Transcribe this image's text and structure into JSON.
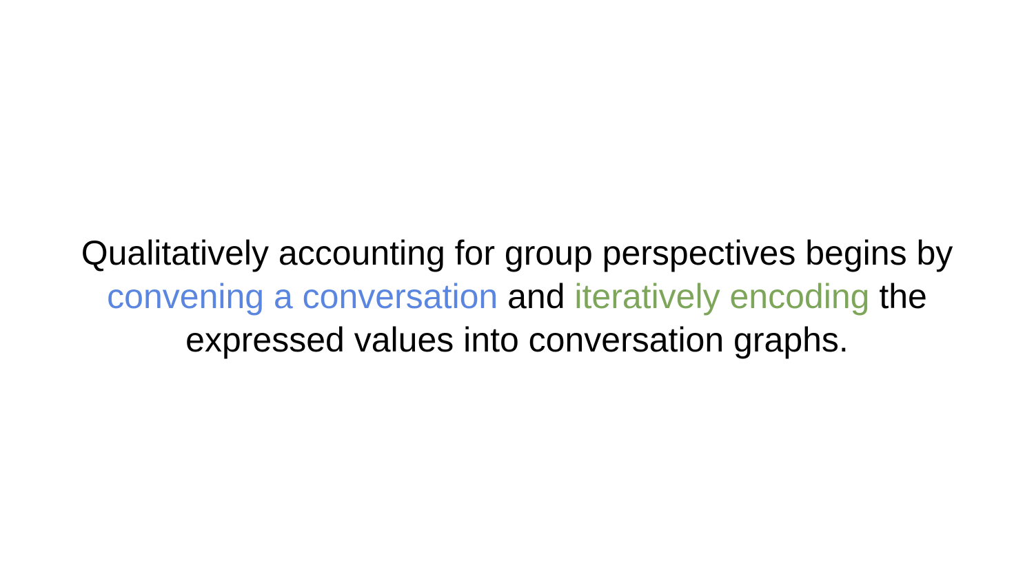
{
  "slide": {
    "line1": "Qualitatively accounting for group perspectives begins by",
    "line2": {
      "highlight1": "convening a conversation",
      "connector": " and ",
      "highlight2": "iteratively encoding",
      "tail": " the"
    },
    "line3": "expressed values into conversation graphs."
  },
  "colors": {
    "text": "#000000",
    "highlight_blue": "#5b86e0",
    "highlight_green": "#7ea65a",
    "background": "#ffffff"
  }
}
